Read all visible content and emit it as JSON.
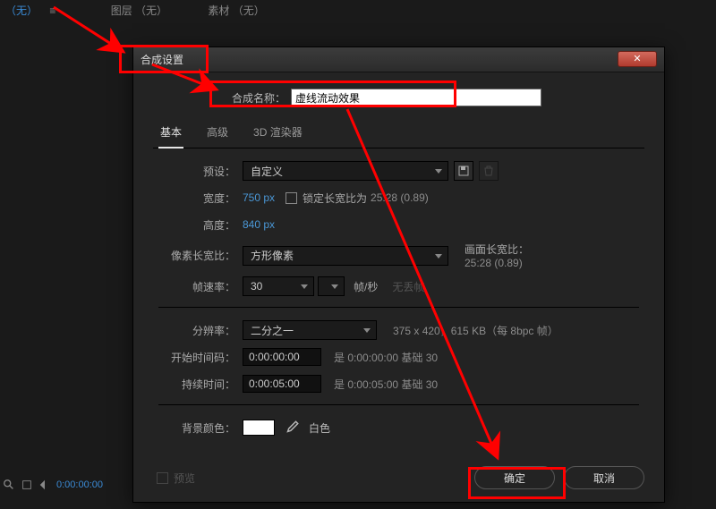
{
  "top": {
    "none": "（无）",
    "layer": "图层 （无）",
    "asset": "素材  （无）"
  },
  "bottombar": {
    "timecode": "0:00:00:00"
  },
  "dialog": {
    "title": "合成设置",
    "close": "✕",
    "name_label": "合成名称：",
    "name_value": "虚线流动效果",
    "tabs": {
      "basic": "基本",
      "advanced": "高级",
      "renderer": "3D 渲染器"
    },
    "preset": {
      "label": "预设：",
      "value": "自定义"
    },
    "width": {
      "label": "宽度：",
      "value": "750 px"
    },
    "height": {
      "label": "高度：",
      "value": "840 px"
    },
    "lock": {
      "label": "锁定长宽比为",
      "ratio": "25:28 (0.89)"
    },
    "par": {
      "label": "像素长宽比：",
      "value": "方形像素",
      "screen_label": "画面长宽比：",
      "screen_value": "25:28 (0.89)"
    },
    "fps": {
      "label": "帧速率：",
      "value": "30",
      "unit": "帧/秒",
      "dropframe": "无丢帧"
    },
    "res": {
      "label": "分辨率：",
      "value": "二分之一",
      "info": "375 x 420，615 KB（每 8bpc 帧）"
    },
    "start": {
      "label": "开始时间码：",
      "value": "0:00:00:00",
      "info": "是 0:00:00:00  基础 30"
    },
    "dur": {
      "label": "持续时间：",
      "value": "0:00:05:00",
      "info": "是 0:00:05:00  基础 30"
    },
    "bg": {
      "label": "背景颜色：",
      "name": "白色"
    },
    "preview": "预览",
    "ok": "确定",
    "cancel": "取消"
  }
}
